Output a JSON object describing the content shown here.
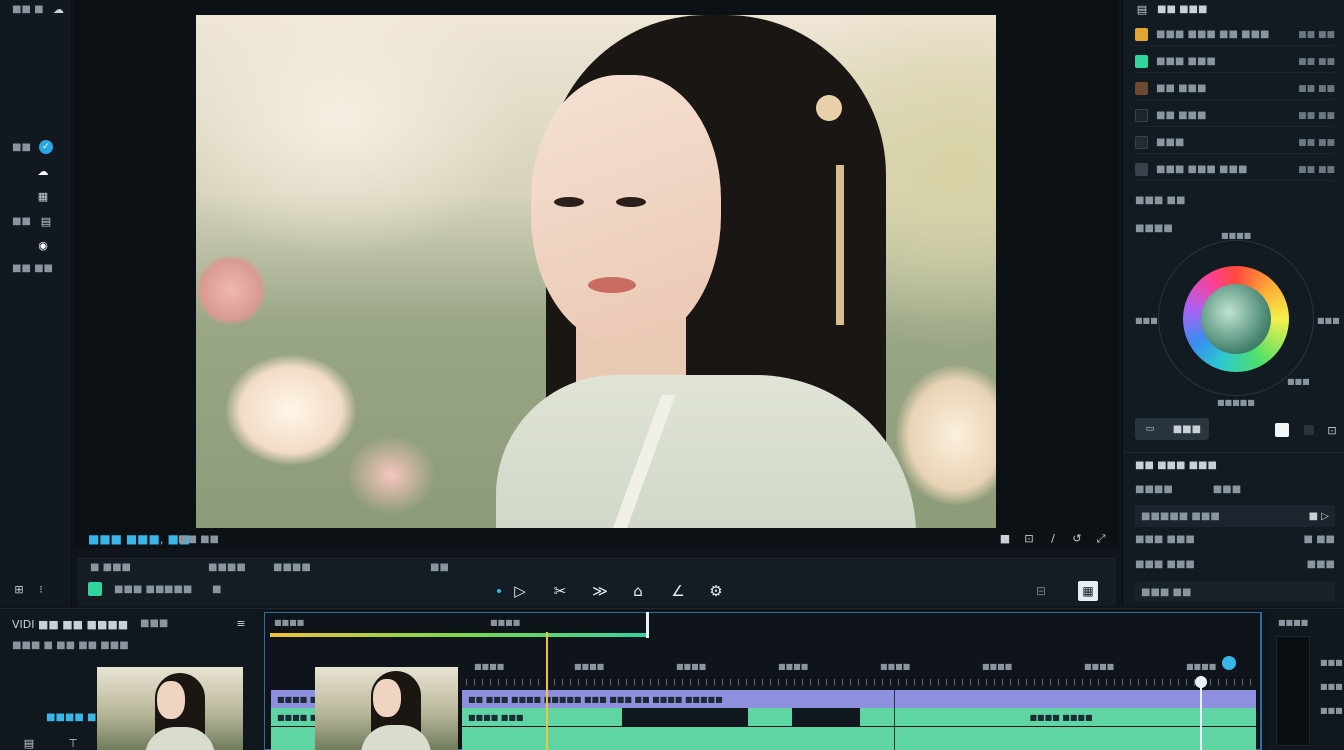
{
  "left_rail": {
    "items": [
      {
        "label": "■■ ■",
        "icon": "cloud-icon"
      },
      {
        "label": "■■",
        "icon": "check-circle-icon",
        "active": true
      },
      {
        "label": "",
        "icon": "cloud-filled-icon"
      },
      {
        "label": "",
        "icon": "grid-icon"
      },
      {
        "label": "■■",
        "icon": "grid-icon"
      },
      {
        "label": "",
        "icon": "record-icon"
      },
      {
        "label": "■■ ■■",
        "icon": "user-icon"
      }
    ]
  },
  "viewer": {
    "title": "■■■ ■■■, ■■",
    "sub_label": "■■ ■■",
    "right_icons": [
      "square-icon",
      "fit-icon",
      "slash-icon",
      "reset-icon",
      "expand-icon"
    ]
  },
  "control_bar": {
    "labels": [
      "■ ■■■",
      "■■■■",
      "■■■■",
      "■■",
      "■■■ ■■",
      "■■■",
      "■"
    ],
    "transport_icons": [
      "play-icon",
      "trim-icon",
      "speed-icon",
      "mask-icon",
      "pen-icon",
      "effects-icon"
    ]
  },
  "right_panel": {
    "header": "■■ ■■■",
    "layers": [
      {
        "label": "■■■ ■■■ ■■ ■■■",
        "value": "■■ ■■",
        "color": "#e2a531"
      },
      {
        "label": "■■■ ■■■",
        "value": "■■ ■■",
        "color": "#2fd59a"
      },
      {
        "label": "■■ ■■■",
        "value": "■■ ■■",
        "color": "#6b4a30"
      },
      {
        "label": "■■ ■■■",
        "value": "■■ ■■",
        "color": "#1f2429"
      },
      {
        "label": "■■■",
        "value": "■■ ■■",
        "color": "#232a30"
      },
      {
        "label": "■■■ ■■■ ■■■",
        "value": "■■ ■■",
        "color": "#3a434b"
      }
    ],
    "color_section_title": "■■■ ■■",
    "wheel_labels": {
      "top_left": "■■■■",
      "top": "■■■■",
      "left": "■■■",
      "right": "■■■",
      "bottom": "■■■■■",
      "bottom_right": "■■■"
    },
    "mode_button": "■■■",
    "properties_title": "■■ ■■■ ■■■",
    "properties": [
      {
        "label": "■■■■",
        "value": "■■■"
      },
      {
        "label": "■■■■■ ■■■",
        "value": "■ ▷"
      },
      {
        "label": "■■■ ■■■",
        "value": "■ ■■"
      },
      {
        "label": "■■■ ■■■",
        "value": "■■■"
      },
      {
        "label": "■■■ ■■",
        "value": ""
      }
    ]
  },
  "timeline": {
    "panel_title": "VIDI ■■ ■■ ■■■■",
    "panel_sub": "■■■ ■ ■■ ■■ ■■■",
    "panel_tab": "■■■",
    "bin_label": "■■■■ ■■■",
    "track_top_labels": [
      "■■■■",
      "■■■■"
    ],
    "ruler_labels": [
      "■■■■",
      "■■■■",
      "■■■■",
      "■■■■",
      "■■■■",
      "■■■■",
      "■■■■",
      "■■■■"
    ],
    "clips": {
      "video_a": "■■ ■■■ ■■■■ ■■■■■ ■■■ ■■■ ■■ ■■■■ ■■■■■",
      "audio_a": "■■■■ ■■■",
      "audio_b": "■■■■ ■■■■",
      "left_a": "■■■■ ■■",
      "left_b": "■■■■ ■■"
    },
    "right_labels": [
      "■■■■",
      "■■■",
      "■■■",
      "■■■"
    ]
  },
  "colors": {
    "accent": "#39b6e8",
    "playhead": "#f2c23a",
    "clip_video": "#8f8fe0",
    "clip_audio": "#5fd5a3"
  }
}
